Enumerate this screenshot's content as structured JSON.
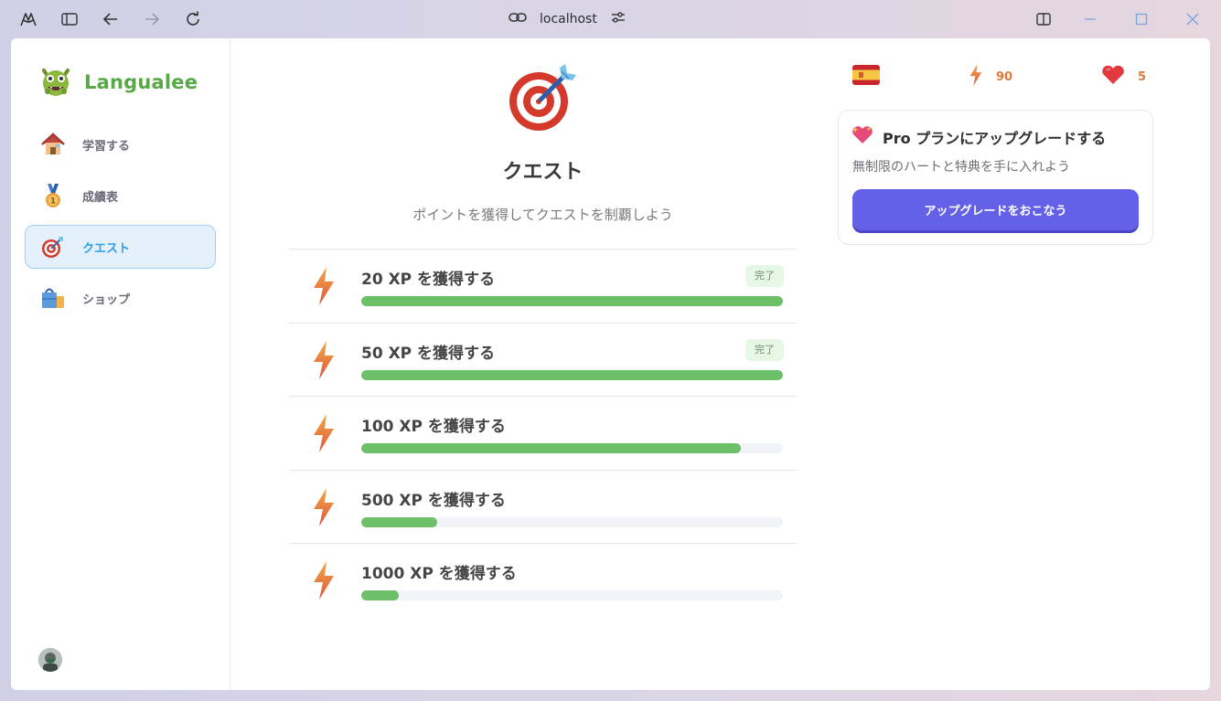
{
  "browser": {
    "url": "localhost",
    "icons": [
      "app-logo-icon",
      "sidebar-toggle-icon",
      "back-arrow-icon",
      "forward-arrow-icon",
      "reload-icon",
      "link-icon",
      "tune-icon",
      "split-view-icon",
      "minimize-icon",
      "maximize-icon",
      "close-icon"
    ]
  },
  "brand": {
    "name": "Langualee",
    "icon": "monster-mascot-icon"
  },
  "sidebar": {
    "items": [
      {
        "label": "学習する",
        "icon": "house-icon",
        "active": false
      },
      {
        "label": "成績表",
        "icon": "medal-icon",
        "active": false
      },
      {
        "label": "クエスト",
        "icon": "target-icon",
        "active": true
      },
      {
        "label": "ショップ",
        "icon": "shopping-bag-icon",
        "active": false
      }
    ]
  },
  "main": {
    "title": "クエスト",
    "subtitle": "ポイントを獲得してクエストを制覇しよう",
    "quests": [
      {
        "title": "20 XP を獲得する",
        "progress": 1.0,
        "badge": "完了"
      },
      {
        "title": "50 XP を獲得する",
        "progress": 1.0,
        "badge": "完了"
      },
      {
        "title": "100 XP を獲得する",
        "progress": 0.9,
        "badge": ""
      },
      {
        "title": "500 XP を獲得する",
        "progress": 0.18,
        "badge": ""
      },
      {
        "title": "1000 XP を獲得する",
        "progress": 0.09,
        "badge": ""
      }
    ]
  },
  "stats": {
    "language_flag": "spain-flag-icon",
    "xp": "90",
    "hearts": "5"
  },
  "pro_card": {
    "title": "Pro プランにアップグレードする",
    "description": "無制限のハートと特典を手に入れよう",
    "button_label": "アップグレードをおこなう"
  },
  "colors": {
    "brand_green": "#58a847",
    "active_blue": "#2f9fe6",
    "progress_green": "#6cc067",
    "button_purple": "#6460e8",
    "stat_orange": "#e07a3a"
  }
}
